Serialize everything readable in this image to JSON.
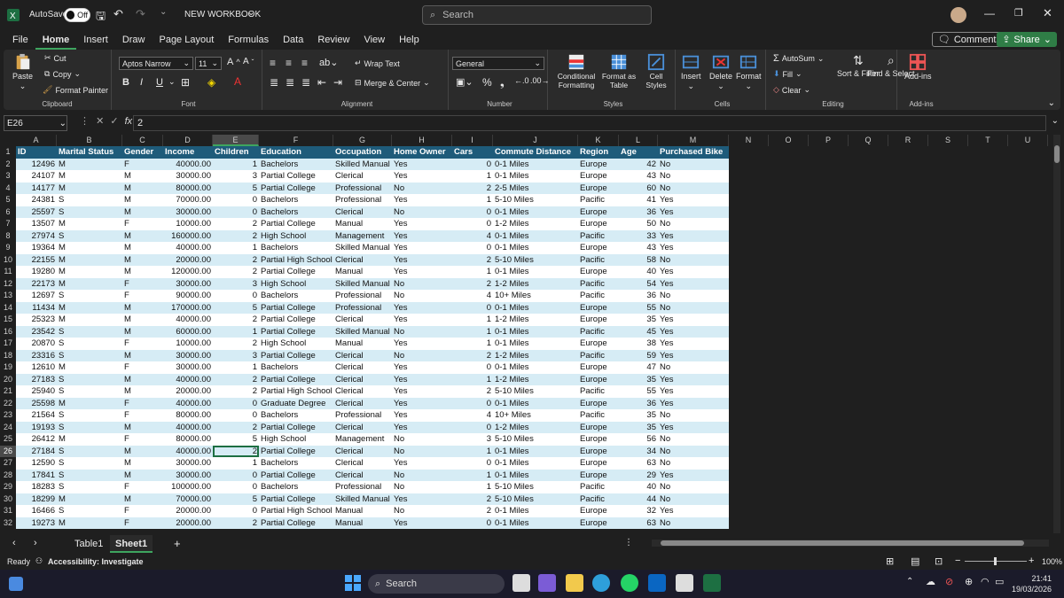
{
  "titlebar": {
    "autosave_label": "AutoSave",
    "autosave_state": "Off",
    "workbook_title": "NEW WORKBOOK",
    "search_placeholder": "Search"
  },
  "menu": {
    "items": [
      "File",
      "Home",
      "Insert",
      "Draw",
      "Page Layout",
      "Formulas",
      "Data",
      "Review",
      "View",
      "Help"
    ],
    "active": "Home",
    "comments_label": "Comments",
    "share_label": "Share"
  },
  "ribbon": {
    "clipboard": {
      "label": "Clipboard",
      "paste": "Paste",
      "cut": "Cut",
      "copy": "Copy",
      "format_painter": "Format Painter"
    },
    "font": {
      "label": "Font",
      "font_name": "Aptos Narrow",
      "font_size": "11",
      "bold": "B",
      "italic": "I",
      "underline": "U"
    },
    "alignment": {
      "label": "Alignment",
      "wrap_text": "Wrap Text",
      "merge_center": "Merge & Center"
    },
    "number": {
      "label": "Number",
      "format": "General"
    },
    "styles": {
      "label": "Styles",
      "conditional": "Conditional Formatting",
      "format_table": "Format as Table",
      "cell_styles": "Cell Styles"
    },
    "cells": {
      "label": "Cells",
      "insert": "Insert",
      "delete": "Delete",
      "format": "Format"
    },
    "editing": {
      "label": "Editing",
      "autosum": "AutoSum",
      "fill": "Fill",
      "clear": "Clear",
      "sort_filter": "Sort & Filter",
      "find_select": "Find & Select"
    },
    "addins": {
      "label": "Add-ins",
      "addins": "Add-ins"
    }
  },
  "formula_bar": {
    "name_box": "E26",
    "value": "2"
  },
  "columns": [
    "A",
    "B",
    "C",
    "D",
    "E",
    "F",
    "G",
    "H",
    "I",
    "J",
    "K",
    "L",
    "M",
    "N",
    "O",
    "P",
    "Q",
    "R",
    "S",
    "T",
    "U"
  ],
  "selected_column": "E",
  "selected_row": 26,
  "table": {
    "headers": [
      "ID",
      "Marital Status",
      "Gender",
      "Income",
      "Children",
      "Education",
      "Occupation",
      "Home Owner",
      "Cars",
      "Commute Distance",
      "Region",
      "Age",
      "Purchased Bike"
    ],
    "rows": [
      [
        "12496",
        "M",
        "F",
        "40000.00",
        "1",
        "Bachelors",
        "Skilled Manual",
        "Yes",
        "0",
        "0-1 Miles",
        "Europe",
        "42",
        "No"
      ],
      [
        "24107",
        "M",
        "M",
        "30000.00",
        "3",
        "Partial College",
        "Clerical",
        "Yes",
        "1",
        "0-1 Miles",
        "Europe",
        "43",
        "No"
      ],
      [
        "14177",
        "M",
        "M",
        "80000.00",
        "5",
        "Partial College",
        "Professional",
        "No",
        "2",
        "2-5 Miles",
        "Europe",
        "60",
        "No"
      ],
      [
        "24381",
        "S",
        "M",
        "70000.00",
        "0",
        "Bachelors",
        "Professional",
        "Yes",
        "1",
        "5-10 Miles",
        "Pacific",
        "41",
        "Yes"
      ],
      [
        "25597",
        "S",
        "M",
        "30000.00",
        "0",
        "Bachelors",
        "Clerical",
        "No",
        "0",
        "0-1 Miles",
        "Europe",
        "36",
        "Yes"
      ],
      [
        "13507",
        "M",
        "F",
        "10000.00",
        "2",
        "Partial College",
        "Manual",
        "Yes",
        "0",
        "1-2 Miles",
        "Europe",
        "50",
        "No"
      ],
      [
        "27974",
        "S",
        "M",
        "160000.00",
        "2",
        "High School",
        "Management",
        "Yes",
        "4",
        "0-1 Miles",
        "Pacific",
        "33",
        "Yes"
      ],
      [
        "19364",
        "M",
        "M",
        "40000.00",
        "1",
        "Bachelors",
        "Skilled Manual",
        "Yes",
        "0",
        "0-1 Miles",
        "Europe",
        "43",
        "Yes"
      ],
      [
        "22155",
        "M",
        "M",
        "20000.00",
        "2",
        "Partial High School",
        "Clerical",
        "Yes",
        "2",
        "5-10 Miles",
        "Pacific",
        "58",
        "No"
      ],
      [
        "19280",
        "M",
        "M",
        "120000.00",
        "2",
        "Partial College",
        "Manual",
        "Yes",
        "1",
        "0-1 Miles",
        "Europe",
        "40",
        "Yes"
      ],
      [
        "22173",
        "M",
        "F",
        "30000.00",
        "3",
        "High School",
        "Skilled Manual",
        "No",
        "2",
        "1-2 Miles",
        "Pacific",
        "54",
        "Yes"
      ],
      [
        "12697",
        "S",
        "F",
        "90000.00",
        "0",
        "Bachelors",
        "Professional",
        "No",
        "4",
        "10+ Miles",
        "Pacific",
        "36",
        "No"
      ],
      [
        "11434",
        "M",
        "M",
        "170000.00",
        "5",
        "Partial College",
        "Professional",
        "Yes",
        "0",
        "0-1 Miles",
        "Europe",
        "55",
        "No"
      ],
      [
        "25323",
        "M",
        "M",
        "40000.00",
        "2",
        "Partial College",
        "Clerical",
        "Yes",
        "1",
        "1-2 Miles",
        "Europe",
        "35",
        "Yes"
      ],
      [
        "23542",
        "S",
        "M",
        "60000.00",
        "1",
        "Partial College",
        "Skilled Manual",
        "No",
        "1",
        "0-1 Miles",
        "Pacific",
        "45",
        "Yes"
      ],
      [
        "20870",
        "S",
        "F",
        "10000.00",
        "2",
        "High School",
        "Manual",
        "Yes",
        "1",
        "0-1 Miles",
        "Europe",
        "38",
        "Yes"
      ],
      [
        "23316",
        "S",
        "M",
        "30000.00",
        "3",
        "Partial College",
        "Clerical",
        "No",
        "2",
        "1-2 Miles",
        "Pacific",
        "59",
        "Yes"
      ],
      [
        "12610",
        "M",
        "F",
        "30000.00",
        "1",
        "Bachelors",
        "Clerical",
        "Yes",
        "0",
        "0-1 Miles",
        "Europe",
        "47",
        "No"
      ],
      [
        "27183",
        "S",
        "M",
        "40000.00",
        "2",
        "Partial College",
        "Clerical",
        "Yes",
        "1",
        "1-2 Miles",
        "Europe",
        "35",
        "Yes"
      ],
      [
        "25940",
        "S",
        "M",
        "20000.00",
        "2",
        "Partial High School",
        "Clerical",
        "Yes",
        "2",
        "5-10 Miles",
        "Pacific",
        "55",
        "Yes"
      ],
      [
        "25598",
        "M",
        "F",
        "40000.00",
        "0",
        "Graduate Degree",
        "Clerical",
        "Yes",
        "0",
        "0-1 Miles",
        "Europe",
        "36",
        "Yes"
      ],
      [
        "21564",
        "S",
        "F",
        "80000.00",
        "0",
        "Bachelors",
        "Professional",
        "Yes",
        "4",
        "10+ Miles",
        "Pacific",
        "35",
        "No"
      ],
      [
        "19193",
        "S",
        "M",
        "40000.00",
        "2",
        "Partial College",
        "Clerical",
        "Yes",
        "0",
        "1-2 Miles",
        "Europe",
        "35",
        "Yes"
      ],
      [
        "26412",
        "M",
        "F",
        "80000.00",
        "5",
        "High School",
        "Management",
        "No",
        "3",
        "5-10 Miles",
        "Europe",
        "56",
        "No"
      ],
      [
        "27184",
        "S",
        "M",
        "40000.00",
        "2",
        "Partial College",
        "Clerical",
        "No",
        "1",
        "0-1 Miles",
        "Europe",
        "34",
        "No"
      ],
      [
        "12590",
        "S",
        "M",
        "30000.00",
        "1",
        "Bachelors",
        "Clerical",
        "Yes",
        "0",
        "0-1 Miles",
        "Europe",
        "63",
        "No"
      ],
      [
        "17841",
        "S",
        "M",
        "30000.00",
        "0",
        "Partial College",
        "Clerical",
        "No",
        "1",
        "0-1 Miles",
        "Europe",
        "29",
        "Yes"
      ],
      [
        "18283",
        "S",
        "F",
        "100000.00",
        "0",
        "Bachelors",
        "Professional",
        "No",
        "1",
        "5-10 Miles",
        "Pacific",
        "40",
        "No"
      ],
      [
        "18299",
        "M",
        "M",
        "70000.00",
        "5",
        "Partial College",
        "Skilled Manual",
        "Yes",
        "2",
        "5-10 Miles",
        "Pacific",
        "44",
        "No"
      ],
      [
        "16466",
        "S",
        "F",
        "20000.00",
        "0",
        "Partial High School",
        "Manual",
        "No",
        "2",
        "0-1 Miles",
        "Europe",
        "32",
        "Yes"
      ],
      [
        "19273",
        "M",
        "F",
        "20000.00",
        "2",
        "Partial College",
        "Manual",
        "Yes",
        "0",
        "0-1 Miles",
        "Europe",
        "63",
        "No"
      ]
    ]
  },
  "sheets": {
    "tabs": [
      "Table1",
      "Sheet1"
    ],
    "active": "Sheet1",
    "add": "+"
  },
  "status": {
    "ready": "Ready",
    "accessibility": "Accessibility: Investigate",
    "zoom": "100%"
  },
  "taskbar": {
    "search": "Search",
    "time": "21:41",
    "date": "19/03/2026"
  },
  "colors": {
    "header_bg": "#1e5b7a",
    "band": "#d6ecf5",
    "accent": "#3ea55f",
    "share": "#2f7d46"
  }
}
